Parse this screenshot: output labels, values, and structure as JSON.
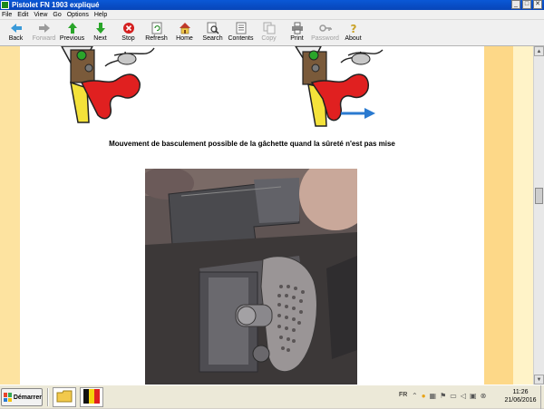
{
  "window": {
    "title": "Pistolet FN 1903 expliqué",
    "min": "_",
    "max": "□",
    "close": "✕"
  },
  "menu": [
    "File",
    "Edit",
    "View",
    "Go",
    "Options",
    "Help"
  ],
  "toolbar": [
    {
      "label": "Back",
      "icon": "arrow-left-icon",
      "enabled": true
    },
    {
      "label": "Forward",
      "icon": "arrow-right-icon",
      "enabled": false
    },
    {
      "label": "Previous",
      "icon": "arrow-up-icon",
      "enabled": true
    },
    {
      "label": "Next",
      "icon": "arrow-down-icon",
      "enabled": true
    },
    {
      "label": "Stop",
      "icon": "stop-icon",
      "enabled": true
    },
    {
      "label": "Refresh",
      "icon": "refresh-icon",
      "enabled": true
    },
    {
      "label": "Home",
      "icon": "home-icon",
      "enabled": true
    },
    {
      "label": "Search",
      "icon": "search-icon",
      "enabled": true
    },
    {
      "label": "Contents",
      "icon": "contents-icon",
      "enabled": true
    },
    {
      "label": "Copy",
      "icon": "copy-icon",
      "enabled": false
    },
    {
      "label": "Print",
      "icon": "print-icon",
      "enabled": true
    },
    {
      "label": "Password",
      "icon": "key-icon",
      "enabled": false
    },
    {
      "label": "About",
      "icon": "help-icon",
      "enabled": true
    }
  ],
  "content": {
    "caption": "Mouvement de basculement possible de la gâchette quand la sûreté n'est pas mise"
  },
  "taskbar": {
    "start_label": "Démarrer",
    "language": "FR",
    "time": "11:26",
    "date": "21/06/2016"
  },
  "colors": {
    "titlebar": "#0a58d6",
    "left_strip": "#fde3a0",
    "right_strip_dark": "#fdd888",
    "right_strip_light": "#fff3c8"
  }
}
